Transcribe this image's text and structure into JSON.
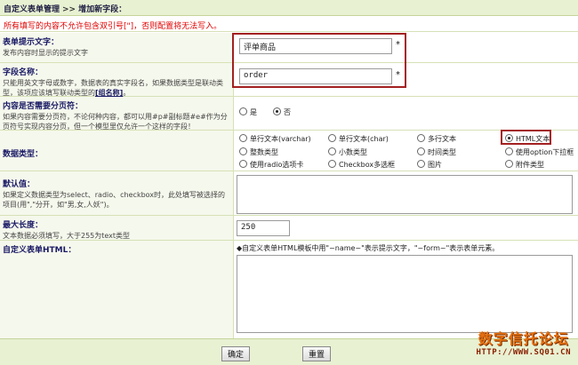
{
  "breadcrumb": {
    "root": "自定义表单管理",
    "sep": ">>",
    "current": "增加新字段："
  },
  "warning": "所有填写的内容不允许包含双引号[\"]，否则配置将无法写入。",
  "fields": {
    "label": {
      "title": "表单提示文字：",
      "desc": "发布内容时显示的提示文字",
      "value": "评单商品",
      "required": "*"
    },
    "name": {
      "title": "字段名称：",
      "desc": "只能用英文字母或数字，数据表的真实字段名，如果数据类型是联动类型，该项应该填写联动类型的",
      "link": "[组名称]",
      "desc_end": "。",
      "value": "order",
      "required": "*"
    },
    "paging": {
      "title": "内容是否需要分页符：",
      "desc": "如果内容需要分页符，不论何种内容，都可以用#p#副标题#e#作为分页符号实现内容分页，但一个模型里仅允许一个这样的字段！",
      "options": [
        "是",
        "否"
      ],
      "selected": "否"
    },
    "datatype": {
      "title": "数据类型：",
      "options": [
        "单行文本(varchar)",
        "单行文本(char)",
        "多行文本",
        "HTML文本",
        "整数类型",
        "小数类型",
        "时间类型",
        "使用option下拉框",
        "使用radio选项卡",
        "Checkbox多选框",
        "图片",
        "附件类型"
      ],
      "selected": "HTML文本"
    },
    "default": {
      "title": "默认值：",
      "desc": "如果定义数据类型为select、radio、checkbox时，此处填写被选择的项目(用\",\"分开，如\"男,女,人妖\")。",
      "value": ""
    },
    "maxlength": {
      "title": "最大长度：",
      "desc": "文本数据必须填写，大于255为text类型",
      "value": "250"
    },
    "html": {
      "title": "自定义表单HTML：",
      "hint": "◆自定义表单HTML模板中用\"~name~\"表示提示文字，\"~form~\"表示表单元素。",
      "value": ""
    }
  },
  "buttons": {
    "ok": "确定",
    "reset": "重置"
  },
  "watermark": {
    "title": "数字信托论坛",
    "url": "HTTP://WWW.SQ01.CN"
  }
}
